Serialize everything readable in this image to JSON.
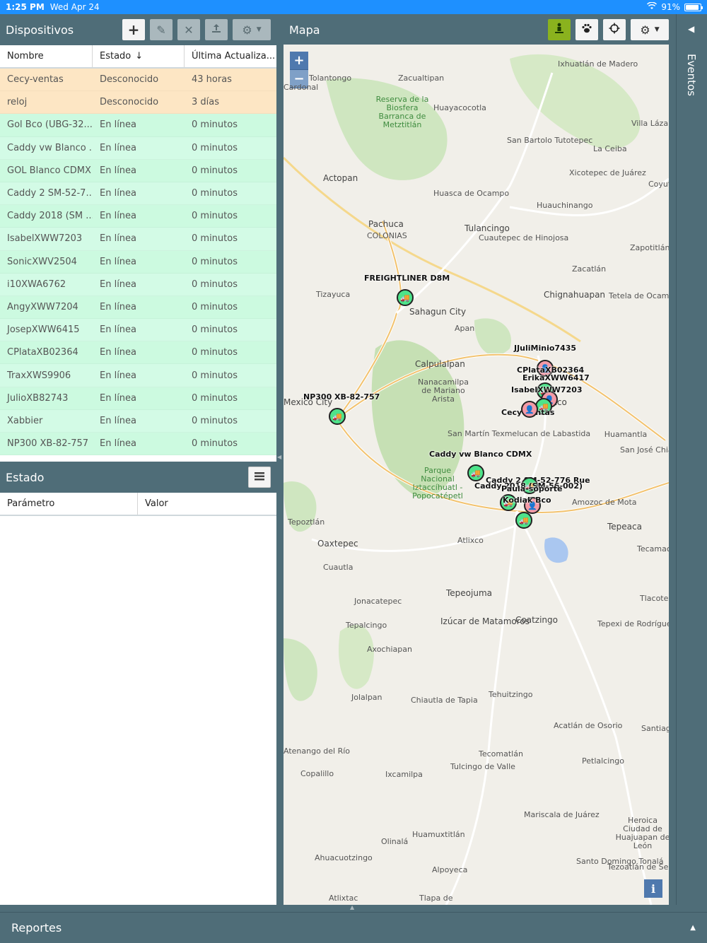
{
  "status_bar": {
    "time": "1:25 PM",
    "date": "Wed Apr 24",
    "battery": "91%",
    "battery_level": 0.91
  },
  "devices_panel": {
    "title": "Dispositivos",
    "columns": [
      "Nombre",
      "Estado",
      "Última Actualiza..."
    ],
    "sort_icon": "arrow-down-icon",
    "rows": [
      {
        "name": "Cecy-ventas",
        "status": "Desconocido",
        "updated": "43 horas",
        "state": "offline"
      },
      {
        "name": "reloj",
        "status": "Desconocido",
        "updated": "3 días",
        "state": "offline"
      },
      {
        "name": "Gol Bco (UBG-32...",
        "status": "En línea",
        "updated": "0 minutos",
        "state": "online"
      },
      {
        "name": "Caddy vw Blanco ...",
        "status": "En línea",
        "updated": "0 minutos",
        "state": "online"
      },
      {
        "name": "GOL Blanco CDMX",
        "status": "En línea",
        "updated": "0 minutos",
        "state": "online"
      },
      {
        "name": "Caddy 2 SM-52-7...",
        "status": "En línea",
        "updated": "0 minutos",
        "state": "online"
      },
      {
        "name": "Caddy 2018 (SM ...",
        "status": "En línea",
        "updated": "0 minutos",
        "state": "online"
      },
      {
        "name": "IsabelXWW7203",
        "status": "En línea",
        "updated": "0 minutos",
        "state": "online"
      },
      {
        "name": "SonicXWV2504",
        "status": "En línea",
        "updated": "0 minutos",
        "state": "online"
      },
      {
        "name": "i10XWA6762",
        "status": "En línea",
        "updated": "0 minutos",
        "state": "online"
      },
      {
        "name": "AngyXWW7204",
        "status": "En línea",
        "updated": "0 minutos",
        "state": "online"
      },
      {
        "name": "JosepXWW6415",
        "status": "En línea",
        "updated": "0 minutos",
        "state": "online"
      },
      {
        "name": "CPlataXB02364",
        "status": "En línea",
        "updated": "0 minutos",
        "state": "online"
      },
      {
        "name": "TraxXWS9906",
        "status": "En línea",
        "updated": "0 minutos",
        "state": "online"
      },
      {
        "name": "JulioXB82743",
        "status": "En línea",
        "updated": "0 minutos",
        "state": "online"
      },
      {
        "name": "Xabbier",
        "status": "En línea",
        "updated": "0 minutos",
        "state": "online"
      },
      {
        "name": "NP300 XB-82-757",
        "status": "En línea",
        "updated": "0 minutos",
        "state": "online"
      }
    ]
  },
  "estado_panel": {
    "title": "Estado",
    "columns": [
      "Parámetro",
      "Valor"
    ]
  },
  "map_panel": {
    "title": "Mapa",
    "zoom_in": "+",
    "zoom_out": "−",
    "info": "i",
    "places": [
      "Tolantongo",
      "Cardonal",
      "Zacualtipan",
      "Ixhuatlán de Madero",
      "Reserva de la Biosfera Barranca de Metztitlán",
      "Huayacocotla",
      "San Bartolo Tutotepec",
      "Villa Lázaro Cárdenas",
      "La Ceiba",
      "Actopan",
      "Xicotepec de Juárez",
      "Huasca de Ocampo",
      "Huauchinango",
      "Coyutla",
      "Pachuca",
      "COLONIAS",
      "Tulancingo",
      "Cuautepec de Hinojosa",
      "Zapotitlán de Méndez",
      "Zacatlán",
      "Tizayuca",
      "Sahagun City",
      "Chignahuapan",
      "Tetela de Ocampo",
      "Apan",
      "Calpulalpan",
      "Nanacamilpa de Mariano Arista",
      "Tlaxco",
      "Mexico City",
      "San Martín Texmelucan de Labastida",
      "Huamantla",
      "San José Chiapa",
      "Parque Nacional Iztaccíhuatl - Popocatépetl",
      "Amozoc de Mota",
      "Tepoztlán",
      "Oaxtepec",
      "Atlixco",
      "Tepeaca",
      "Tecamachalco",
      "Cuautla",
      "Tepeojuma",
      "Jonacatepec",
      "Tlacotepec de Benito",
      "Tepalcingo",
      "Izúcar de Matamoros",
      "Coatzingo",
      "Tepexi de Rodríguez",
      "Axochiapan",
      "Jolalpan",
      "Chiautla de Tapia",
      "Tehuitzingo",
      "Acatlán de Osorio",
      "Santiago Chazumba",
      "Atenango del Río",
      "Copalillo",
      "Ixcamilpa",
      "Tecomatlán",
      "Tulcingo de Valle",
      "Petlalcingo",
      "Mariscala de Juárez",
      "Heroica Ciudad de Huajuapan de León",
      "Olinalá",
      "Huamuxtitlán",
      "Ahuacuotzingo",
      "Alpoyeca",
      "Santo Domingo Tonalá",
      "Tezoatlán de Segura y Luna",
      "Atlixtac",
      "Tlapa de"
    ],
    "vehicles": [
      "FREIGHTLINER D8M",
      "JJuliMinio7435",
      "CPlataXB02364",
      "ErikaXWW6417",
      "IsabelXWW7203",
      "Cecy-ventas",
      "NP300 XB-82-757",
      "Caddy vw Blanco CDMX",
      "Caddy 2 SM-52-776 Rue",
      "Caddy 2018 (SM-56-002)",
      "Paula-soporte",
      "Kodiak Bco"
    ],
    "colors": {
      "online_marker": "#4ee38a",
      "offline_marker": "#f39aa6"
    }
  },
  "events_panel": {
    "title": "Eventos"
  },
  "reports_panel": {
    "title": "Reportes"
  }
}
